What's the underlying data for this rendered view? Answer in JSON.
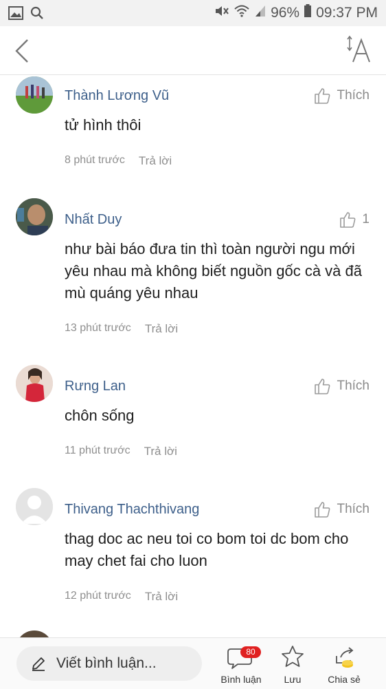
{
  "status_bar": {
    "battery": "96%",
    "time": "09:37 PM"
  },
  "comments": [
    {
      "name": "Thành Lương Vũ",
      "text": "tử hình thôi",
      "time": "8 phút trước",
      "reply": "Trả lời",
      "like_label": "Thích"
    },
    {
      "name": "Nhất Duy",
      "text": "như bài báo đưa tin thì toàn người ngu mới yêu nhau mà không biết nguồn gốc cà và đã mù quáng yêu nhau",
      "time": "13 phút trước",
      "reply": "Trả lời",
      "like_label": "1"
    },
    {
      "name": "Rưng Lan",
      "text": "chôn sống",
      "time": "11 phút trước",
      "reply": "Trả lời",
      "like_label": "Thích"
    },
    {
      "name": "Thivang Thachthivang",
      "text": "thag doc ac neu toi co bom toi dc bom cho may chet fai cho luon",
      "time": "12 phút trước",
      "reply": "Trả lời",
      "like_label": "Thích"
    }
  ],
  "bottom_bar": {
    "write_placeholder": "Viết bình luận...",
    "comments_label": "Bình luận",
    "comments_count": "80",
    "save_label": "Lưu",
    "share_label": "Chia sẻ"
  },
  "colors": {
    "name": "#3d5f8a",
    "badge": "#e02020"
  }
}
